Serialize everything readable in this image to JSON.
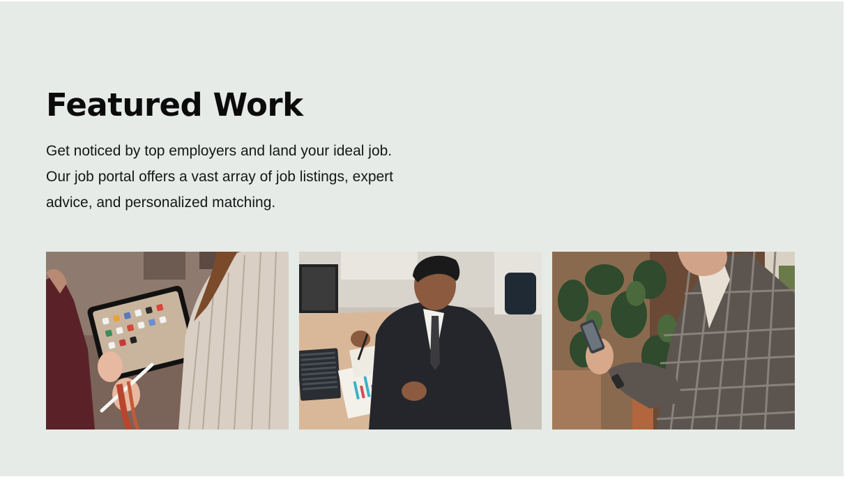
{
  "section": {
    "title": "Featured Work",
    "description": "Get noticed by top employers and land your ideal job. Our job portal offers a vast array of job listings, expert advice, and personalized matching."
  },
  "gallery": {
    "items": [
      {
        "subject": "woman holding tablet with stylus"
      },
      {
        "subject": "man in suit reviewing charts at desk"
      },
      {
        "subject": "man in plaid blazer using smartphone"
      }
    ]
  }
}
